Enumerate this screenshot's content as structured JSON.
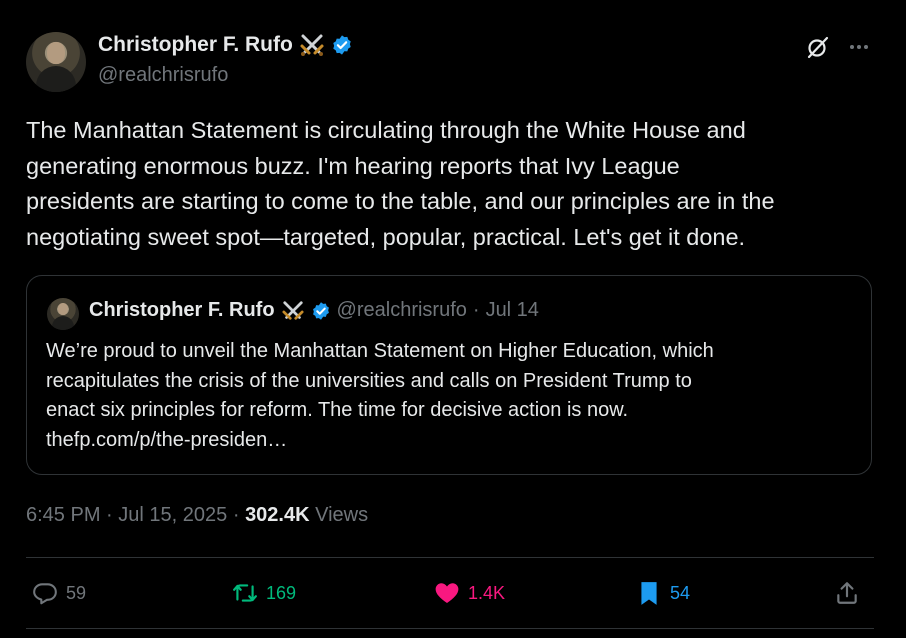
{
  "author": {
    "name": "Christopher F. Rufo",
    "handle": "@realchrisrufo",
    "badge_icon": "crossed-swords-icon",
    "verified_color": "#1d9bf0"
  },
  "tweet": {
    "text": "The Manhattan Statement is circulating through the White House and\ngenerating enormous buzz. I'm hearing reports that Ivy League\npresidents are starting to come to the table, and our principles are in the\nnegotiating sweet spot—targeted, popular, practical. Let's get it done."
  },
  "quote": {
    "name": "Christopher F. Rufo",
    "handle": "@realchrisrufo",
    "separator": "·",
    "date": "Jul 14",
    "text": "We’re proud to unveil the Manhattan Statement on Higher Education, which\nrecapitulates the crisis of the universities and calls on President Trump to\nenact six principles for reform. The time for decisive action is now.\nthefp.com/p/the-presiden…"
  },
  "meta": {
    "time": "6:45 PM",
    "separator": "·",
    "date": "Jul 15, 2025",
    "separator2": "·",
    "views_count": "302.4K",
    "views_label": "Views"
  },
  "actions": {
    "replies": "59",
    "reposts": "169",
    "likes": "1.4K",
    "bookmarks": "54"
  },
  "colors": {
    "background": "#000000",
    "text": "#e7e9ea",
    "secondary": "#71767b",
    "repost": "#00ba7c",
    "like": "#f91880",
    "bookmark": "#1d9bf0"
  }
}
